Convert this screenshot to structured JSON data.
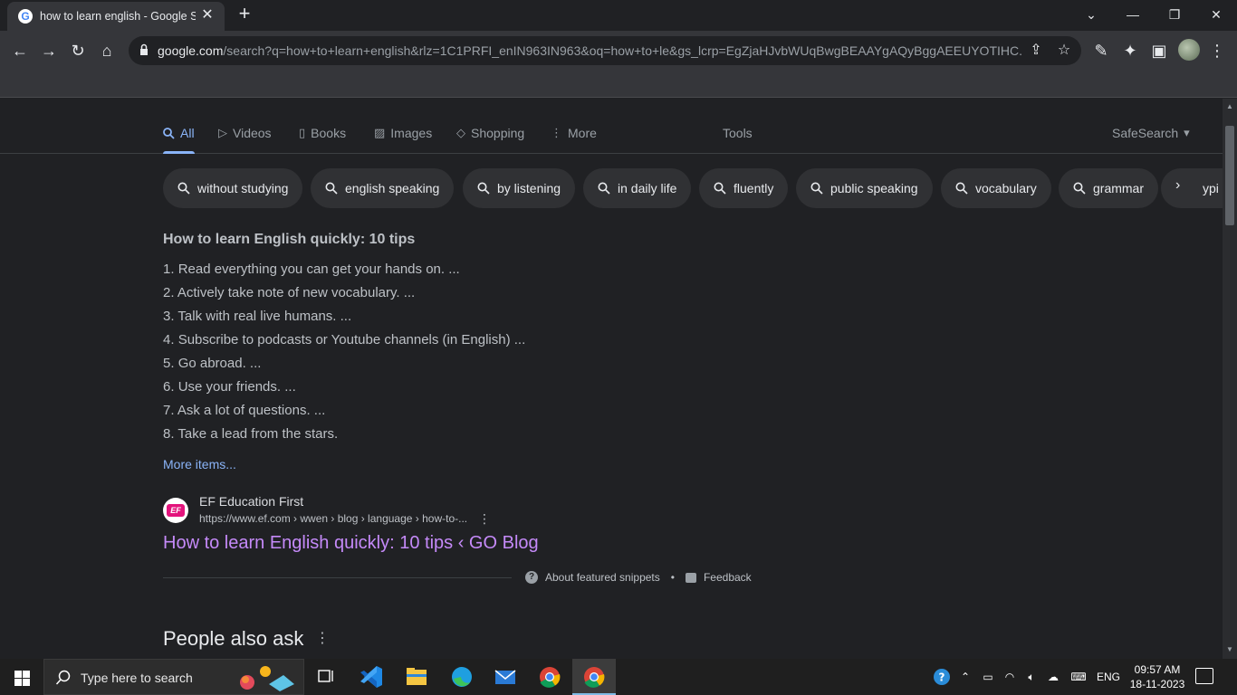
{
  "browser": {
    "tab": {
      "title": "how to learn english - Google Se",
      "close_icon": "close-icon"
    },
    "new_tab_label": "+",
    "window_controls": [
      "chevron-down-icon",
      "minimize-icon",
      "restore-icon",
      "close-icon"
    ],
    "url_host": "google.com",
    "url_rest": "/search?q=how+to+learn+english&rlz=1C1PRFI_enIN963IN963&oq=how+to+le&gs_lcrp=EgZjaHJvbWUqBwgBEAAYgAQyBggAEEUYOTIHC..."
  },
  "search_nav": {
    "tabs": [
      {
        "label": "All",
        "icon": "search-icon",
        "active": true
      },
      {
        "label": "Videos",
        "icon": "video-icon"
      },
      {
        "label": "Books",
        "icon": "book-icon"
      },
      {
        "label": "Images",
        "icon": "image-icon"
      },
      {
        "label": "Shopping",
        "icon": "tag-icon"
      },
      {
        "label": "More",
        "icon": "more-vert-icon"
      }
    ],
    "tools": "Tools",
    "safesearch": "SafeSearch"
  },
  "chips": [
    "without studying",
    "english speaking",
    "by listening",
    "in daily life",
    "fluently",
    "public speaking",
    "vocabulary",
    "grammar"
  ],
  "chip_partial": "ypi",
  "snippet": {
    "title": "How to learn English quickly: 10 tips",
    "tips": [
      "Read everything you can get your hands on. ...",
      "Actively take note of new vocabulary. ...",
      "Talk with real live humans. ...",
      "Subscribe to podcasts or Youtube channels (in English) ...",
      "Go abroad. ...",
      "Use your friends. ...",
      "Ask a lot of questions. ...",
      "Take a lead from the stars."
    ],
    "more_items": "More items...",
    "source_logo": "EF",
    "source_name": "EF Education First",
    "source_url": "https://www.ef.com › wwen › blog › language › how-to-...",
    "result_title": "How to learn English quickly: 10 tips ‹ GO Blog",
    "about": "About featured snippets",
    "dot": "•",
    "feedback": "Feedback"
  },
  "people_also_ask": "People also ask",
  "taskbar": {
    "search_placeholder": "Type here to search",
    "language": "ENG",
    "time": "09:57 AM",
    "date": "18-11-2023"
  }
}
